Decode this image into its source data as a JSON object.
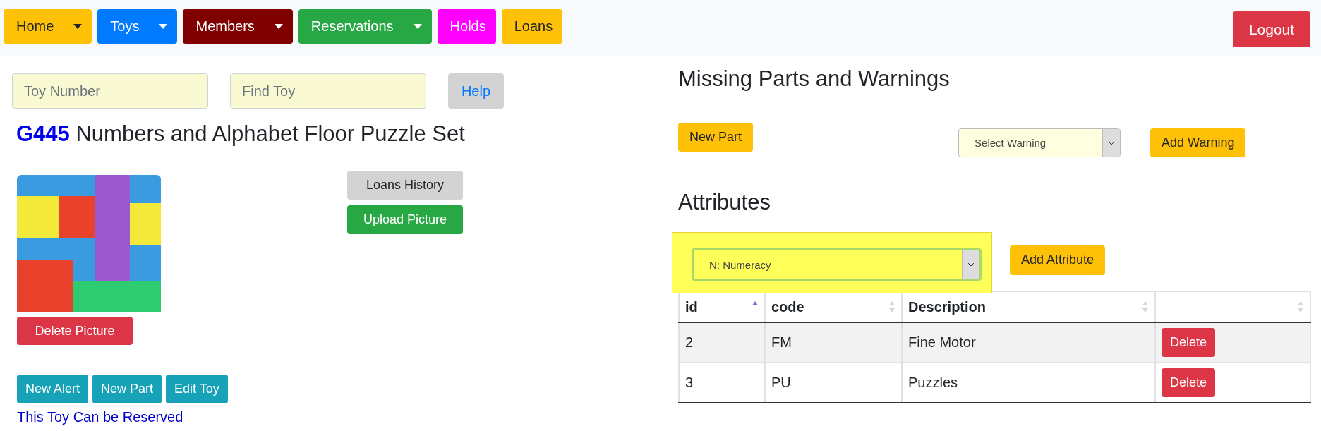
{
  "nav": {
    "items": [
      {
        "label": "Home",
        "color": "#ffc107",
        "dropdown": true
      },
      {
        "label": "Toys",
        "color": "#007bff",
        "dropdown": true
      },
      {
        "label": "Members",
        "color": "#800000",
        "dropdown": true
      },
      {
        "label": "Reservations",
        "color": "#28a745",
        "dropdown": true
      },
      {
        "label": "Holds",
        "color": "#ff00ff",
        "dropdown": false
      },
      {
        "label": "Loans",
        "color": "#ffc107",
        "dropdown": false
      }
    ],
    "logout": "Logout"
  },
  "search": {
    "toy_number": {
      "placeholder": "Toy Number"
    },
    "find_toy": {
      "placeholder": "Find Toy"
    },
    "help": "Help"
  },
  "toy": {
    "code": "G445",
    "name": "Numbers and Alphabet Floor Puzzle Set",
    "delete_picture": "Delete Picture",
    "loans_history": "Loans History",
    "upload_picture": "Upload Picture",
    "actions": [
      "New Alert",
      "New Part",
      "Edit Toy"
    ],
    "status": "This Toy Can be Reserved"
  },
  "missing_parts": {
    "title": "Missing Parts and Warnings",
    "new_part": "New Part",
    "warning_select": {
      "value": "Select Warning"
    },
    "add_warning": "Add Warning"
  },
  "attributes": {
    "title": "Attributes",
    "select": {
      "value": "N: Numeracy",
      "highlighted": true
    },
    "add_attribute": "Add Attribute",
    "table": {
      "columns": [
        {
          "label": "id",
          "sorted_ascending": true
        },
        {
          "label": "code",
          "sorted_ascending": false
        },
        {
          "label": "Description",
          "sorted_ascending": false
        },
        {
          "sorted_ascending": false
        }
      ],
      "rows": [
        {
          "id": "2",
          "code": "FM",
          "description": "Fine Motor",
          "action": "Delete"
        },
        {
          "id": "3",
          "code": "PU",
          "description": "Puzzles",
          "action": "Delete"
        }
      ]
    }
  }
}
